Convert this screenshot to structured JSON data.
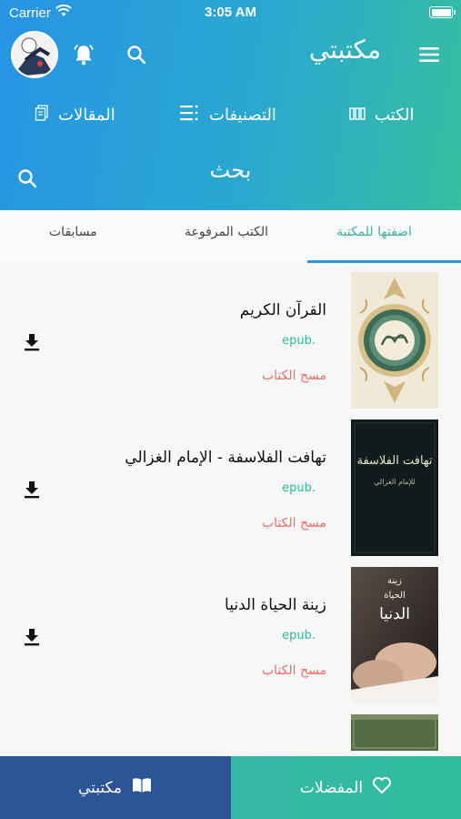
{
  "status_bar": {
    "carrier": "Carrier",
    "time": "3:05 AM"
  },
  "header": {
    "app_title": "مكتبتي",
    "nav": [
      {
        "label": "الكتب",
        "icon": "books-icon"
      },
      {
        "label": "التصنيفات",
        "icon": "list-icon"
      },
      {
        "label": "المقالات",
        "icon": "articles-icon"
      }
    ],
    "search_label": "بحث"
  },
  "subtabs": [
    {
      "label": "اضفتها للمكتبة",
      "active": true
    },
    {
      "label": "الكتب المرفوعة",
      "active": false
    },
    {
      "label": "مسابقات",
      "active": false
    }
  ],
  "books": [
    {
      "title": "القرآن الكريم",
      "format": "epub.",
      "delete_label": "مسح الكتاب"
    },
    {
      "title": "تهافت الفلاسفة - الإمام الغزالي",
      "format": "epub.",
      "delete_label": "مسح الكتاب"
    },
    {
      "title": "زينة الحياة الدنيا",
      "format": "epub.",
      "delete_label": "مسح الكتاب"
    }
  ],
  "cover_text": {
    "book2_title": "تهافت الفلاسفة",
    "book2_author": "للإمام الغزالي",
    "book3_line1": "زينة",
    "book3_line2": "الحياة",
    "book3_line3": "الدنيا"
  },
  "bottom_bar": {
    "library_label": "مكتبتي",
    "favorites_label": "المفضلات"
  },
  "colors": {
    "accent_green": "#34b59a",
    "accent_blue": "#2e96df",
    "delete_red": "#f06b6b",
    "bottom_blue": "#2c5596"
  }
}
